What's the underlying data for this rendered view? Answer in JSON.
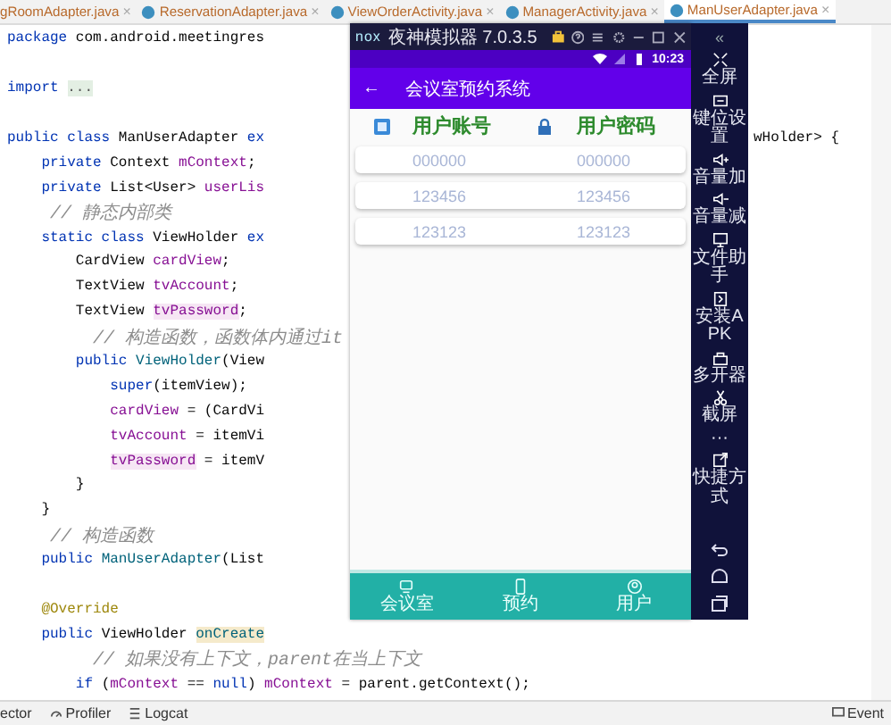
{
  "editor_tabs": [
    {
      "label": "gRoomAdapter.java",
      "close": "×",
      "icon": false,
      "selected": false
    },
    {
      "label": "ReservationAdapter.java",
      "close": "×",
      "icon": true,
      "selected": false
    },
    {
      "label": "ViewOrderActivity.java",
      "close": "×",
      "icon": true,
      "selected": false
    },
    {
      "label": "ManagerActivity.java",
      "close": "×",
      "icon": true,
      "selected": false
    },
    {
      "label": "ManUserAdapter.java",
      "close": "×",
      "icon": true,
      "selected": true
    }
  ],
  "code_lines": [
    {
      "kind": "code",
      "tokens": [
        {
          "kind": "kw",
          "text": "package"
        },
        {
          "kind": "plain",
          "text": " com.android.meetingres"
        }
      ]
    },
    {
      "kind": "blank"
    },
    {
      "kind": "code",
      "tokens": [
        {
          "kind": "kw",
          "text": "import "
        },
        {
          "kind": "fold",
          "text": "..."
        }
      ]
    },
    {
      "kind": "blank"
    },
    {
      "kind": "code",
      "tokens": [
        {
          "kind": "kw",
          "text": "public class"
        },
        {
          "kind": "plain",
          "text": " ManUserAdapter "
        },
        {
          "kind": "kw",
          "text": "ex"
        }
      ],
      "right": [
        {
          "kind": "plain",
          "text": "wHolder> {"
        }
      ]
    },
    {
      "kind": "code",
      "tokens": [
        {
          "kind": "kw",
          "text": "    private"
        },
        {
          "kind": "plain",
          "text": " Context "
        },
        {
          "kind": "field",
          "text": "mContext"
        },
        {
          "kind": "plain",
          "text": ";"
        }
      ]
    },
    {
      "kind": "code",
      "tokens": [
        {
          "kind": "kw",
          "text": "    private"
        },
        {
          "kind": "plain",
          "text": " List<User> "
        },
        {
          "kind": "field",
          "text": "userLis"
        }
      ]
    },
    {
      "kind": "code",
      "tokens": [
        {
          "kind": "comment",
          "text": "    // 静态内部类"
        }
      ]
    },
    {
      "kind": "code",
      "tokens": [
        {
          "kind": "kw",
          "text": "    static class"
        },
        {
          "kind": "plain",
          "text": " ViewHolder "
        },
        {
          "kind": "kw",
          "text": "ex"
        }
      ]
    },
    {
      "kind": "code",
      "tokens": [
        {
          "kind": "plain",
          "text": "        CardView "
        },
        {
          "kind": "field",
          "text": "cardView"
        },
        {
          "kind": "plain",
          "text": ";"
        }
      ]
    },
    {
      "kind": "code",
      "tokens": [
        {
          "kind": "plain",
          "text": "        TextView "
        },
        {
          "kind": "field",
          "text": "tvAccount"
        },
        {
          "kind": "plain",
          "text": ";"
        }
      ]
    },
    {
      "kind": "code",
      "tokens": [
        {
          "kind": "plain",
          "text": "        TextView "
        },
        {
          "kind": "field_hl",
          "text": "tvPassword"
        },
        {
          "kind": "plain",
          "text": ";"
        }
      ]
    },
    {
      "kind": "code",
      "tokens": [
        {
          "kind": "comment",
          "text": "        // 构造函数，函数体内通过it"
        }
      ]
    },
    {
      "kind": "code",
      "tokens": [
        {
          "kind": "kw",
          "text": "        public "
        },
        {
          "kind": "method",
          "text": "ViewHolder"
        },
        {
          "kind": "plain",
          "text": "(View"
        }
      ]
    },
    {
      "kind": "code",
      "tokens": [
        {
          "kind": "kw",
          "text": "            super"
        },
        {
          "kind": "plain",
          "text": "(itemView);"
        }
      ]
    },
    {
      "kind": "code",
      "tokens": [
        {
          "kind": "field",
          "text": "            cardView"
        },
        {
          "kind": "plain",
          "text": " = (CardVi"
        }
      ]
    },
    {
      "kind": "code",
      "tokens": [
        {
          "kind": "field",
          "text": "            tvAccount"
        },
        {
          "kind": "plain",
          "text": " = itemVi"
        }
      ]
    },
    {
      "kind": "code",
      "tokens": [
        {
          "kind": "field_hl",
          "text": "            tvPassword"
        },
        {
          "kind": "plain",
          "text": " = itemV"
        }
      ]
    },
    {
      "kind": "code",
      "tokens": [
        {
          "kind": "plain",
          "text": "        }"
        }
      ]
    },
    {
      "kind": "code",
      "tokens": [
        {
          "kind": "plain",
          "text": "    }"
        }
      ]
    },
    {
      "kind": "code",
      "tokens": [
        {
          "kind": "comment",
          "text": "    // 构造函数"
        }
      ]
    },
    {
      "kind": "code",
      "tokens": [
        {
          "kind": "kw",
          "text": "    public "
        },
        {
          "kind": "method",
          "text": "ManUserAdapter"
        },
        {
          "kind": "plain",
          "text": "(List"
        }
      ]
    },
    {
      "kind": "blank"
    },
    {
      "kind": "code",
      "tokens": [
        {
          "kind": "annotation",
          "text": "    @Override"
        }
      ]
    },
    {
      "kind": "code",
      "tokens": [
        {
          "kind": "kw",
          "text": "    public"
        },
        {
          "kind": "plain",
          "text": " ViewHolder "
        },
        {
          "kind": "method_hl",
          "text": "onCreate"
        }
      ]
    },
    {
      "kind": "code",
      "tokens": [
        {
          "kind": "comment",
          "text": "        // 如果没有上下文，parent在当上下文"
        }
      ]
    },
    {
      "kind": "code",
      "tokens": [
        {
          "kind": "kw",
          "text": "        if"
        },
        {
          "kind": "plain",
          "text": " ("
        },
        {
          "kind": "field",
          "text": "mContext"
        },
        {
          "kind": "plain",
          "text": " == "
        },
        {
          "kind": "kw",
          "text": "null"
        },
        {
          "kind": "plain",
          "text": ") "
        },
        {
          "kind": "field",
          "text": "mContext"
        },
        {
          "kind": "plain",
          "text": " = parent.getContext();"
        }
      ]
    }
  ],
  "status_bar": {
    "items": [
      {
        "kind": "text",
        "label": "ector"
      },
      {
        "kind": "profiler",
        "label": "Profiler"
      },
      {
        "kind": "logcat",
        "label": "Logcat"
      }
    ],
    "right": "Event"
  },
  "emulator": {
    "brand": "nox",
    "title": "夜神模拟器 7.0.3.5",
    "clock": "10:23",
    "back": "←",
    "app_title": "会议室预约系统",
    "columns": [
      "用户账号",
      "用户密码"
    ],
    "rows": [
      {
        "account": "000000",
        "password": "000000"
      },
      {
        "account": "123456",
        "password": "123456"
      },
      {
        "account": "123123",
        "password": "123123"
      }
    ],
    "nav": [
      {
        "kind": "room",
        "label": "会议室"
      },
      {
        "kind": "phone",
        "label": "预约"
      },
      {
        "kind": "user",
        "label": "用户"
      }
    ]
  },
  "sidebar": {
    "collapse": "«",
    "items": [
      {
        "kind": "fullscreen",
        "label": "全屏"
      },
      {
        "kind": "keys",
        "label": "键位设置"
      },
      {
        "kind": "vol_up",
        "label": "音量加"
      },
      {
        "kind": "vol_down",
        "label": "音量减"
      },
      {
        "kind": "files",
        "label": "文件助手"
      },
      {
        "kind": "apk",
        "label": "安装APK"
      },
      {
        "kind": "multi",
        "label": "多开器"
      },
      {
        "kind": "screenshot",
        "label": "截屏"
      },
      {
        "kind": "more",
        "label": "···"
      },
      {
        "kind": "shortcut",
        "label": "快捷方式"
      }
    ]
  }
}
